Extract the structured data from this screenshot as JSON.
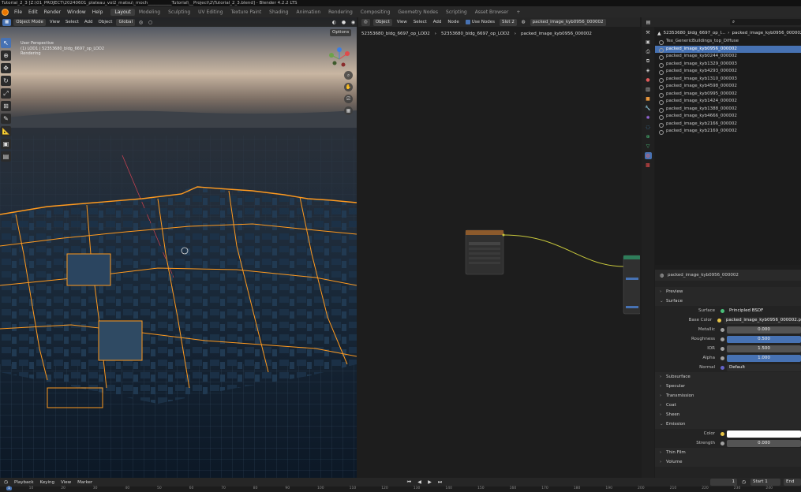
{
  "window_title": "Tutorial_2_3 [Z:\\01_PROJECT\\20240601_plateau_vol2_matsu\\_moch___________Tutorial\\__Project\\2\\Tutorial_2_3.blend] - Blender 4.2.2 LTS",
  "menu": [
    "File",
    "Edit",
    "Render",
    "Window",
    "Help"
  ],
  "workspaces": [
    "Layout",
    "Modeling",
    "Sculpting",
    "UV Editing",
    "Texture Paint",
    "Shading",
    "Animation",
    "Rendering",
    "Compositing",
    "Geometry Nodes",
    "Scripting",
    "Asset Browser"
  ],
  "active_workspace": "Layout",
  "viewport": {
    "mode": "Object Mode",
    "menus": [
      "View",
      "Select",
      "Add",
      "Object"
    ],
    "orientation": "Global",
    "options_label": "Options",
    "info_line1": "User Perspective",
    "info_line2": "(1) LOD1 | 52353680_bldg_6697_op_LOD2",
    "info_line3": "Rendering"
  },
  "node_editor": {
    "object_label": "Object",
    "menus": [
      "View",
      "Select",
      "Add",
      "Node"
    ],
    "use_nodes_label": "Use Nodes",
    "slot_label": "Slot 2",
    "material_name": "packed_image_kyb0956_000002",
    "breadcrumb": [
      "52353680_bldg_6697_op_LOD2",
      "52353680_bldg_6697_op_LOD2",
      "packed_image_kyb0956_000002"
    ]
  },
  "outliner": {
    "header": "52353680_bldg_6697_op_l...",
    "header_material": "packed_image_kyb0956_000002",
    "images": [
      "Tex_GenericBuildings_top_Diffuse",
      "packed_image_kyb0956_000002",
      "packed_image_kyb0244_000002",
      "packed_image_kyb1329_000003",
      "packed_image_kyb4293_000002",
      "packed_image_kyb1310_000003",
      "packed_image_kyb4598_000002",
      "packed_image_kyb0995_000002",
      "packed_image_kyb1424_000002",
      "packed_image_kyb1388_000002",
      "packed_image_kyb4666_000002",
      "packed_image_kyb2166_000002",
      "packed_image_kyb2169_000002"
    ],
    "selected_index": 1
  },
  "properties": {
    "material_name": "packed_image_kyb0956_000002",
    "preview_label": "Preview",
    "surface_panel": "Surface",
    "surface_label": "Surface",
    "surface_value": "Principled BSDF",
    "fields": [
      {
        "label": "Base Color",
        "value": "packed_image_kyb0956_000002.p",
        "style": "dark",
        "dot": "#e8c547"
      },
      {
        "label": "Metallic",
        "value": "0.000",
        "style": "grey",
        "dot": "#a1a1a1"
      },
      {
        "label": "Roughness",
        "value": "0.500",
        "style": "blue",
        "dot": "#a1a1a1"
      },
      {
        "label": "IOR",
        "value": "1.500",
        "style": "grey",
        "dot": "#a1a1a1"
      },
      {
        "label": "Alpha",
        "value": "1.000",
        "style": "blue",
        "dot": "#a1a1a1"
      },
      {
        "label": "Normal",
        "value": "Default",
        "style": "dark",
        "dot": "#6363c7"
      }
    ],
    "subpanels": [
      "Subsurface",
      "Specular",
      "Transmission",
      "Coat",
      "Sheen"
    ],
    "emission_panel": "Emission",
    "emission_color_label": "Color",
    "emission_strength_label": "Strength",
    "emission_strength": "0.000",
    "thin_film": "Thin Film",
    "volume": "Volume"
  },
  "timeline": {
    "menus": [
      "Playback",
      "Keying",
      "View",
      "Marker"
    ],
    "current_frame": "1",
    "start_label": "Start",
    "start_value": "1",
    "end_label": "End",
    "ticks": [
      "10",
      "20",
      "30",
      "40",
      "50",
      "60",
      "70",
      "80",
      "90",
      "100",
      "110",
      "120",
      "130",
      "140",
      "150",
      "160",
      "170",
      "180",
      "190",
      "200",
      "210",
      "220",
      "230",
      "240"
    ]
  },
  "colors": {
    "accent": "#4772b3",
    "selection_outline": "#ff9a1f",
    "node_link": "#c8c83c",
    "blender_orange": "#ea7600"
  }
}
